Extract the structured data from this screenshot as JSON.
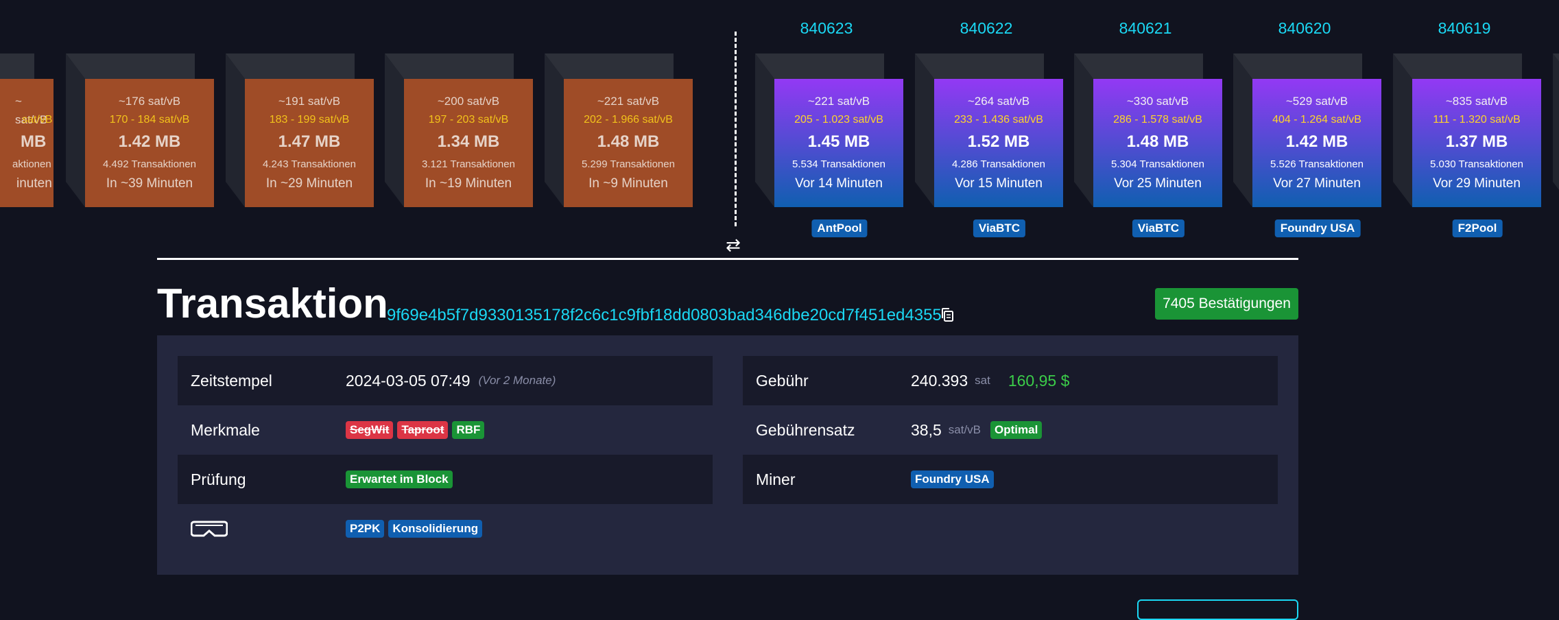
{
  "pending_blocks": [
    {
      "fee": "~ sat/vB",
      "range": "sat/vB",
      "size": "MB",
      "txs": "aktionen",
      "time": "inuten"
    },
    {
      "fee": "~176 sat/vB",
      "range": "170 - 184 sat/vB",
      "size": "1.42 MB",
      "txs": "4.492 Transaktionen",
      "time": "In ~39 Minuten"
    },
    {
      "fee": "~191 sat/vB",
      "range": "183 - 199 sat/vB",
      "size": "1.47 MB",
      "txs": "4.243 Transaktionen",
      "time": "In ~29 Minuten"
    },
    {
      "fee": "~200 sat/vB",
      "range": "197 - 203 sat/vB",
      "size": "1.34 MB",
      "txs": "3.121 Transaktionen",
      "time": "In ~19 Minuten"
    },
    {
      "fee": "~221 sat/vB",
      "range": "202 - 1.966 sat/vB",
      "size": "1.48 MB",
      "txs": "5.299 Transaktionen",
      "time": "In ~9 Minuten"
    }
  ],
  "mined_blocks": [
    {
      "height": "840623",
      "fee": "~221 sat/vB",
      "range": "205 - 1.023 sat/vB",
      "size": "1.45 MB",
      "txs": "5.534 Transaktionen",
      "time": "Vor 14 Minuten",
      "pool": "AntPool"
    },
    {
      "height": "840622",
      "fee": "~264 sat/vB",
      "range": "233 - 1.436 sat/vB",
      "size": "1.52 MB",
      "txs": "4.286 Transaktionen",
      "time": "Vor 15 Minuten",
      "pool": "ViaBTC"
    },
    {
      "height": "840621",
      "fee": "~330 sat/vB",
      "range": "286 - 1.578 sat/vB",
      "size": "1.48 MB",
      "txs": "5.304 Transaktionen",
      "time": "Vor 25 Minuten",
      "pool": "ViaBTC"
    },
    {
      "height": "840620",
      "fee": "~529 sat/vB",
      "range": "404 - 1.264 sat/vB",
      "size": "1.42 MB",
      "txs": "5.526 Transaktionen",
      "time": "Vor 27 Minuten",
      "pool": "Foundry USA"
    },
    {
      "height": "840619",
      "fee": "~835 sat/vB",
      "range": "111 - 1.320 sat/vB",
      "size": "1.37 MB",
      "txs": "5.030 Transaktionen",
      "time": "Vor 29 Minuten",
      "pool": "F2Pool"
    }
  ],
  "swap_icon": "arrows-swap-icon",
  "transaction": {
    "title": "Transaktion",
    "txid": "9f69e4b5f7d9330135178f2c6c1c9fbf18dd0803bad346dbe20cd7f451ed4355",
    "confirmations": "7405 Bestätigungen",
    "copy_icon": "copy-icon"
  },
  "details": {
    "timestamp_label": "Zeitstempel",
    "timestamp_value": "2024-03-05 07:49",
    "timestamp_relative": "(Vor 2 Monate)",
    "features_label": "Merkmale",
    "features": [
      "SegWit",
      "Taproot",
      "RBF"
    ],
    "audit_label": "Prüfung",
    "audit_value": "Erwartet im Block",
    "goggles_icon": "goggles-icon",
    "goggles_tags": [
      "P2PK",
      "Konsolidierung"
    ],
    "fee_label": "Gebühr",
    "fee_value": "240.393",
    "fee_unit": "sat",
    "fee_usd": "160,95 $",
    "feerate_label": "Gebührensatz",
    "feerate_value": "38,5",
    "feerate_unit": "sat/vB",
    "feerate_badge": "Optimal",
    "miner_label": "Miner",
    "miner_value": "Foundry USA"
  },
  "colors": {
    "background": "#11131f",
    "accent": "#1bd8f4",
    "pending_block": "#9f4c27",
    "mined_gradient_top": "#9339f4",
    "mined_gradient_bottom": "#105fb0",
    "success": "#1a9436",
    "danger": "#dc3545"
  }
}
